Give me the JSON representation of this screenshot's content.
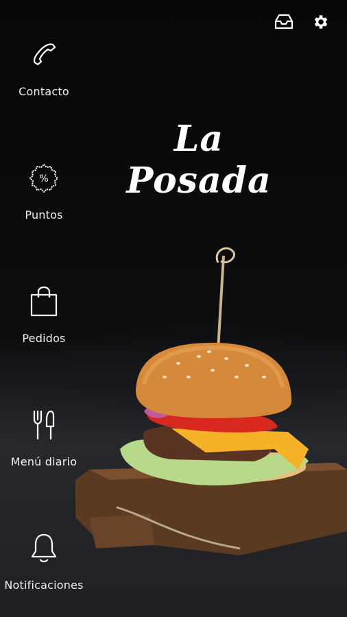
{
  "app": {
    "brand_title": "La Posada"
  },
  "header": {
    "actions": [
      {
        "icon": "inbox-icon"
      },
      {
        "icon": "gear-icon"
      }
    ]
  },
  "sidebar": {
    "items": [
      {
        "label": "Contacto",
        "icon": "phone-icon"
      },
      {
        "label": "Puntos",
        "icon": "percent-badge-icon"
      },
      {
        "label": "Pedidos",
        "icon": "shopping-bag-icon"
      },
      {
        "label": "Menú diario",
        "icon": "fork-knife-icon"
      },
      {
        "label": "Notificaciones",
        "icon": "bell-icon"
      }
    ]
  },
  "background": {
    "image": "burger-on-wooden-board"
  }
}
